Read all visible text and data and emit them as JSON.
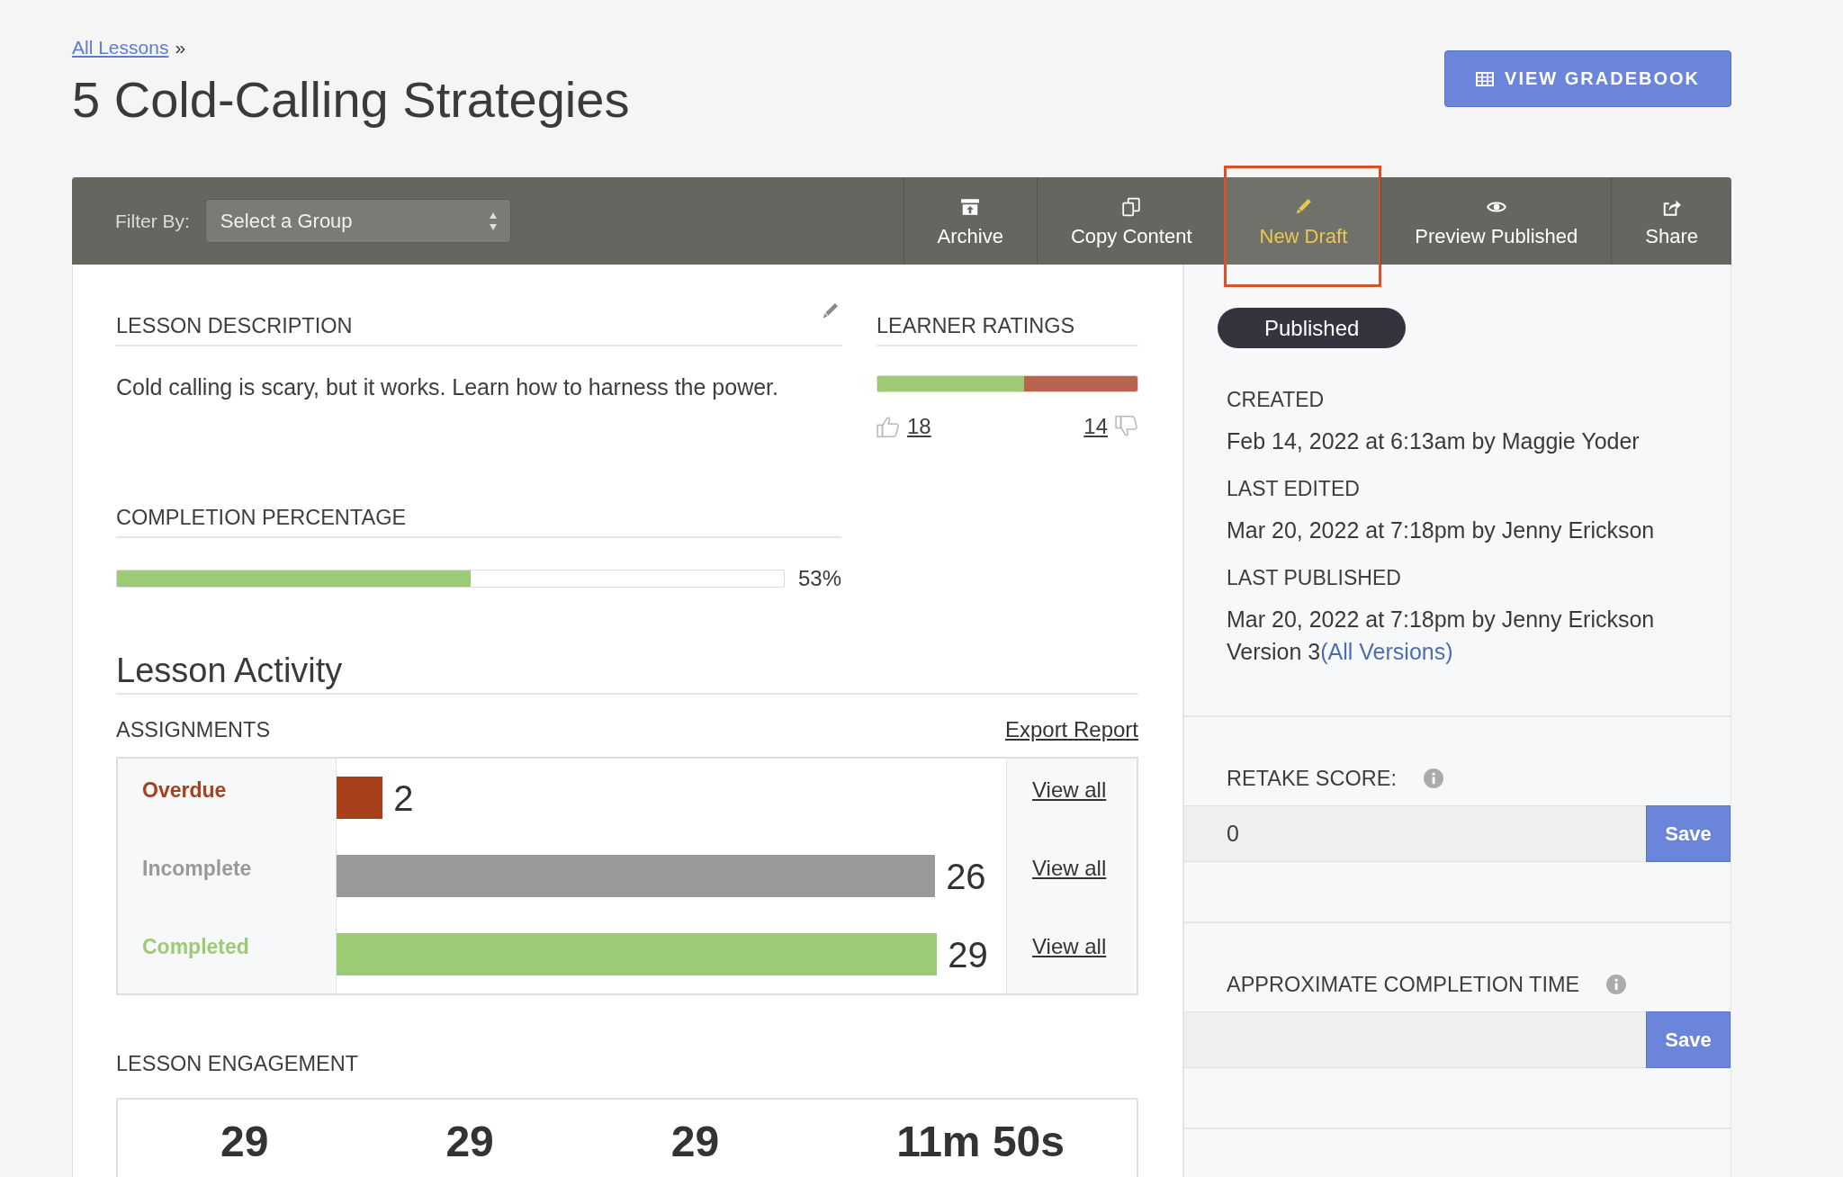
{
  "breadcrumb": {
    "link": "All Lessons",
    "separator": "»"
  },
  "title": "5 Cold-Calling Strategies",
  "gradebook_button": {
    "label": "VIEW GRADEBOOK"
  },
  "toolbar": {
    "filter": {
      "label": "Filter By:",
      "placeholder": "Select a Group"
    },
    "actions": [
      {
        "label": "Archive",
        "kind": "archive",
        "selected": false,
        "highlighted": false
      },
      {
        "label": "Copy Content",
        "kind": "copy",
        "selected": false,
        "highlighted": false
      },
      {
        "label": "New Draft",
        "kind": "draft",
        "selected": true,
        "highlighted": true
      },
      {
        "label": "Preview Published",
        "kind": "preview",
        "selected": false,
        "highlighted": false
      },
      {
        "label": "Share",
        "kind": "share",
        "selected": false,
        "highlighted": false
      }
    ]
  },
  "description": {
    "heading": "LESSON DESCRIPTION",
    "text": "Cold calling is scary, but it works. Learn how to harness the power."
  },
  "ratings": {
    "heading": "LEARNER RATINGS",
    "level": 0.5625,
    "up": "18",
    "down": "14"
  },
  "completion": {
    "heading": "COMPLETION PERCENTAGE",
    "level": 0.53,
    "reading": "53%"
  },
  "activity": {
    "title": "Lesson Activity",
    "assignments": {
      "heading": "ASSIGNMENTS",
      "export_link": "Export Report",
      "rows": [
        {
          "label": "Overdue",
          "color": "#a8401c",
          "level": 0.069,
          "count": "2",
          "link": "View all"
        },
        {
          "label": "Incomplete",
          "color": "#999999",
          "level": 0.894,
          "count": "26",
          "link": "View all"
        },
        {
          "label": "Completed",
          "color": "#9dca74",
          "level": 0.897,
          "count": "29",
          "link": "View all"
        }
      ]
    },
    "engagement": {
      "heading": "LESSON ENGAGEMENT",
      "stats": [
        "29",
        "29",
        "29",
        "11m 50s"
      ]
    }
  },
  "sidebar": {
    "status": "Published",
    "meta": [
      {
        "label": "CREATED",
        "value": "Feb 14, 2022 at 6:13am by Maggie Yoder"
      },
      {
        "label": "LAST EDITED",
        "value": "Mar 20, 2022 at 7:18pm by Jenny Erickson"
      },
      {
        "label": "LAST PUBLISHED",
        "value": "Mar 20, 2022 at 7:18pm by Jenny Erickson",
        "version": "Version 3",
        "version_link": "(All Versions)"
      }
    ],
    "settings": [
      {
        "label": "RETAKE SCORE:",
        "value": "0",
        "button": "Save"
      },
      {
        "label": "APPROXIMATE COMPLETION TIME",
        "button": "Save"
      }
    ]
  }
}
